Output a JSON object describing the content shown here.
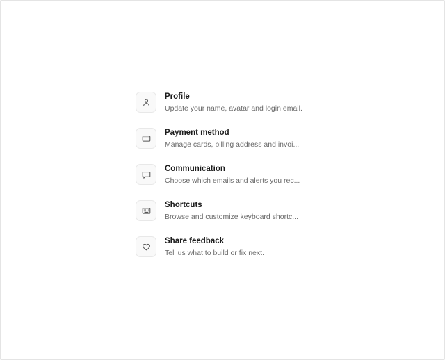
{
  "menu": {
    "items": [
      {
        "icon": "user-icon",
        "title": "Profile",
        "description": "Update your name, avatar and login email."
      },
      {
        "icon": "credit-card-icon",
        "title": "Payment method",
        "description": "Manage cards, billing address and invoi..."
      },
      {
        "icon": "message-bubble-icon",
        "title": "Communication",
        "description": "Choose which emails and alerts you rec..."
      },
      {
        "icon": "keyboard-icon",
        "title": "Shortcuts",
        "description": "Browse and customize keyboard shortc..."
      },
      {
        "icon": "heart-icon",
        "title": "Share feedback",
        "description": "Tell us what to build or fix next."
      }
    ]
  },
  "colors": {
    "title": "#1c1c1c",
    "description": "#6a6a6a",
    "icon_stroke": "#555555",
    "icon_box_bg": "#f9f9f9",
    "icon_box_border": "#e8e8e8"
  }
}
